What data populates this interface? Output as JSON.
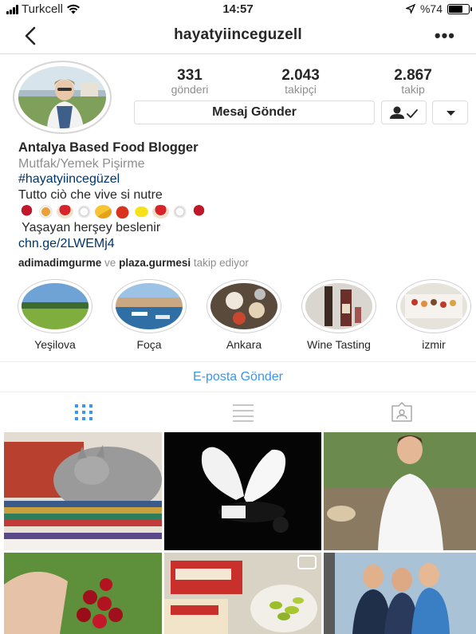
{
  "status_bar": {
    "carrier": "Turkcell",
    "time": "14:57",
    "battery": "%74",
    "battery_level": 0.74
  },
  "nav": {
    "title": "hayatyiinceguzell",
    "back_icon": "chevron-left-icon",
    "more_icon": "more-dots-icon"
  },
  "stats": {
    "posts": {
      "count": "331",
      "label": "gönderi"
    },
    "followers": {
      "count": "2.043",
      "label": "takipçi"
    },
    "following": {
      "count": "2.867",
      "label": "takip"
    }
  },
  "actions": {
    "message_label": "Mesaj Gönder",
    "following_icon": "person-check-icon",
    "dropdown_icon": "caret-down-icon"
  },
  "bio": {
    "name": "Antalya Based Food Blogger",
    "category": "Mutfak/Yemek Pişirme",
    "hashtag": "#hayatyiincegüzel",
    "line1": "Tutto ciò che vive si nutre",
    "emojis": [
      "wine",
      "spaghetti",
      "mushroom",
      "plate",
      "cheese",
      "tomato",
      "lemon",
      "mushroom",
      "plate",
      "wine"
    ],
    "line2": " Yaşayan herşey beslenir",
    "link": "chn.ge/2LWEMj4",
    "followed_by_1": "adimadimgurme",
    "followed_by_and": "ve",
    "followed_by_2": "plaza.gurmesi",
    "followed_by_suffix": "takip ediyor"
  },
  "highlights": [
    {
      "label": "Yeşilova"
    },
    {
      "label": "Foça"
    },
    {
      "label": "Ankara"
    },
    {
      "label": "Wine Tasting"
    },
    {
      "label": "izmir"
    }
  ],
  "email_label": "E-posta Gönder",
  "tabs": [
    {
      "icon": "grid-icon",
      "active": true
    },
    {
      "icon": "list-icon",
      "active": false
    },
    {
      "icon": "tagged-icon",
      "active": false
    }
  ],
  "colors": {
    "link_blue": "#3897f0",
    "dark_link": "#003569",
    "muted": "#8e8e8e",
    "border": "#dbdbdb"
  }
}
